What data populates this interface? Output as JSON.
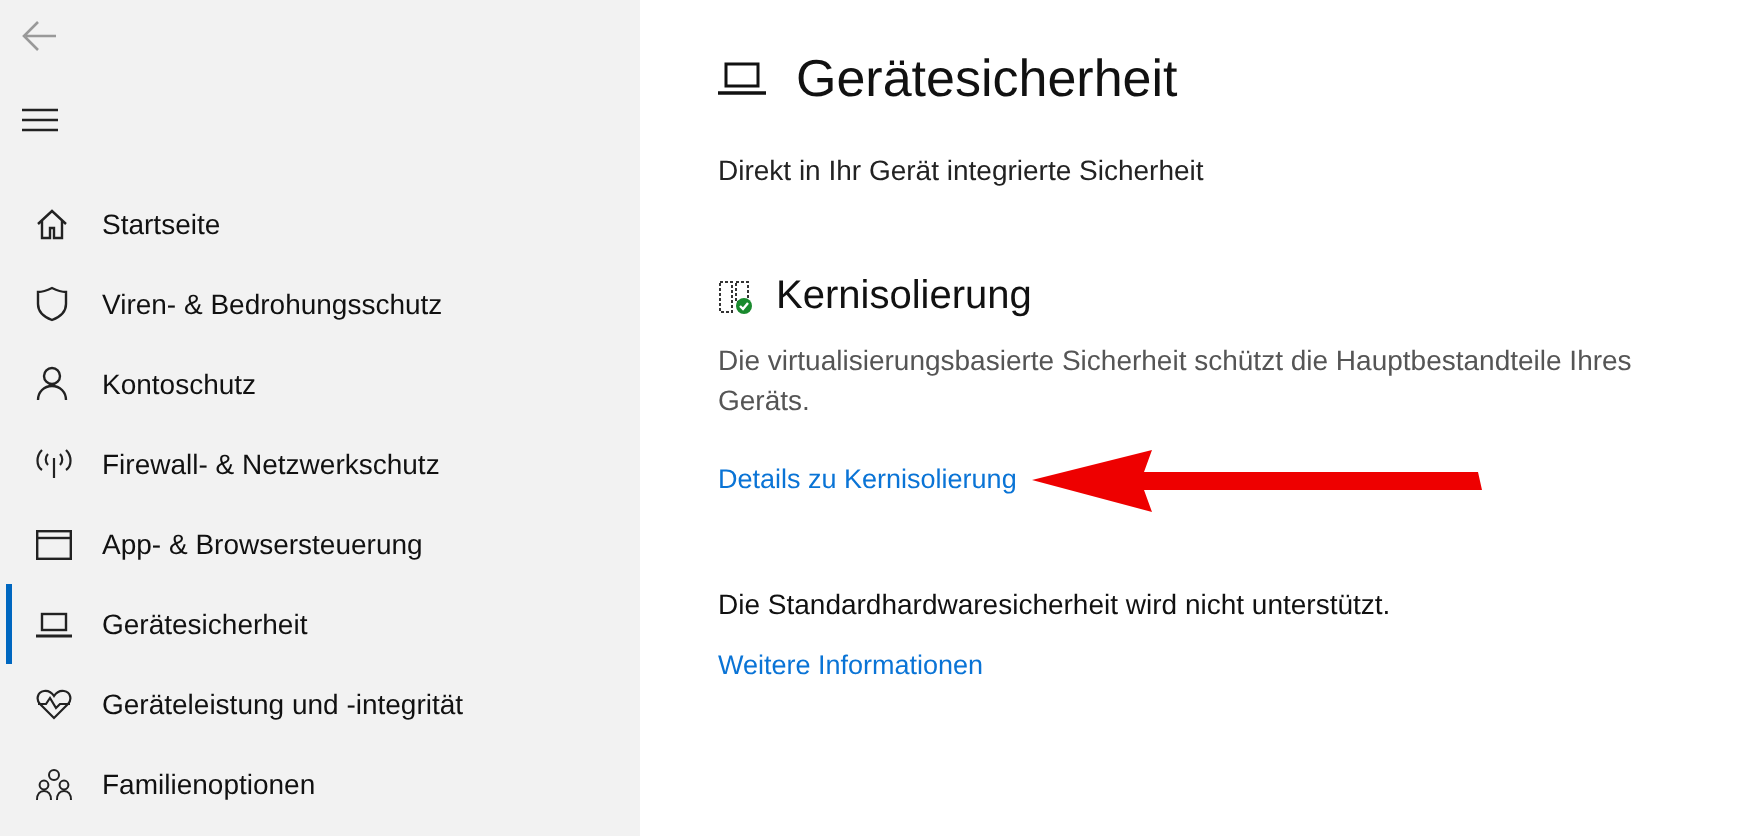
{
  "sidebar": {
    "items": [
      {
        "kind": "home",
        "label": "Startseite",
        "selected": false
      },
      {
        "kind": "shield",
        "label": "Viren- & Bedrohungsschutz",
        "selected": false
      },
      {
        "kind": "person",
        "label": "Kontoschutz",
        "selected": false
      },
      {
        "kind": "antenna",
        "label": "Firewall- & Netzwerkschutz",
        "selected": false
      },
      {
        "kind": "window",
        "label": "App- & Browsersteuerung",
        "selected": false
      },
      {
        "kind": "laptop",
        "label": "Gerätesicherheit",
        "selected": true
      },
      {
        "kind": "heart",
        "label": "Geräteleistung und -integrität",
        "selected": false
      },
      {
        "kind": "family",
        "label": "Familienoptionen",
        "selected": false
      }
    ]
  },
  "page": {
    "title": "Gerätesicherheit",
    "subtitle": "Direkt in Ihr Gerät integrierte Sicherheit"
  },
  "core_isolation": {
    "heading": "Kernisolierung",
    "description": "Die virtualisierungsbasierte Sicherheit schützt die Hauptbestandteile Ihres Geräts.",
    "link": "Details zu Kernisolierung"
  },
  "hardware": {
    "message": "Die Standardhardwaresicherheit wird nicht unterstützt.",
    "link": "Weitere Informationen"
  }
}
